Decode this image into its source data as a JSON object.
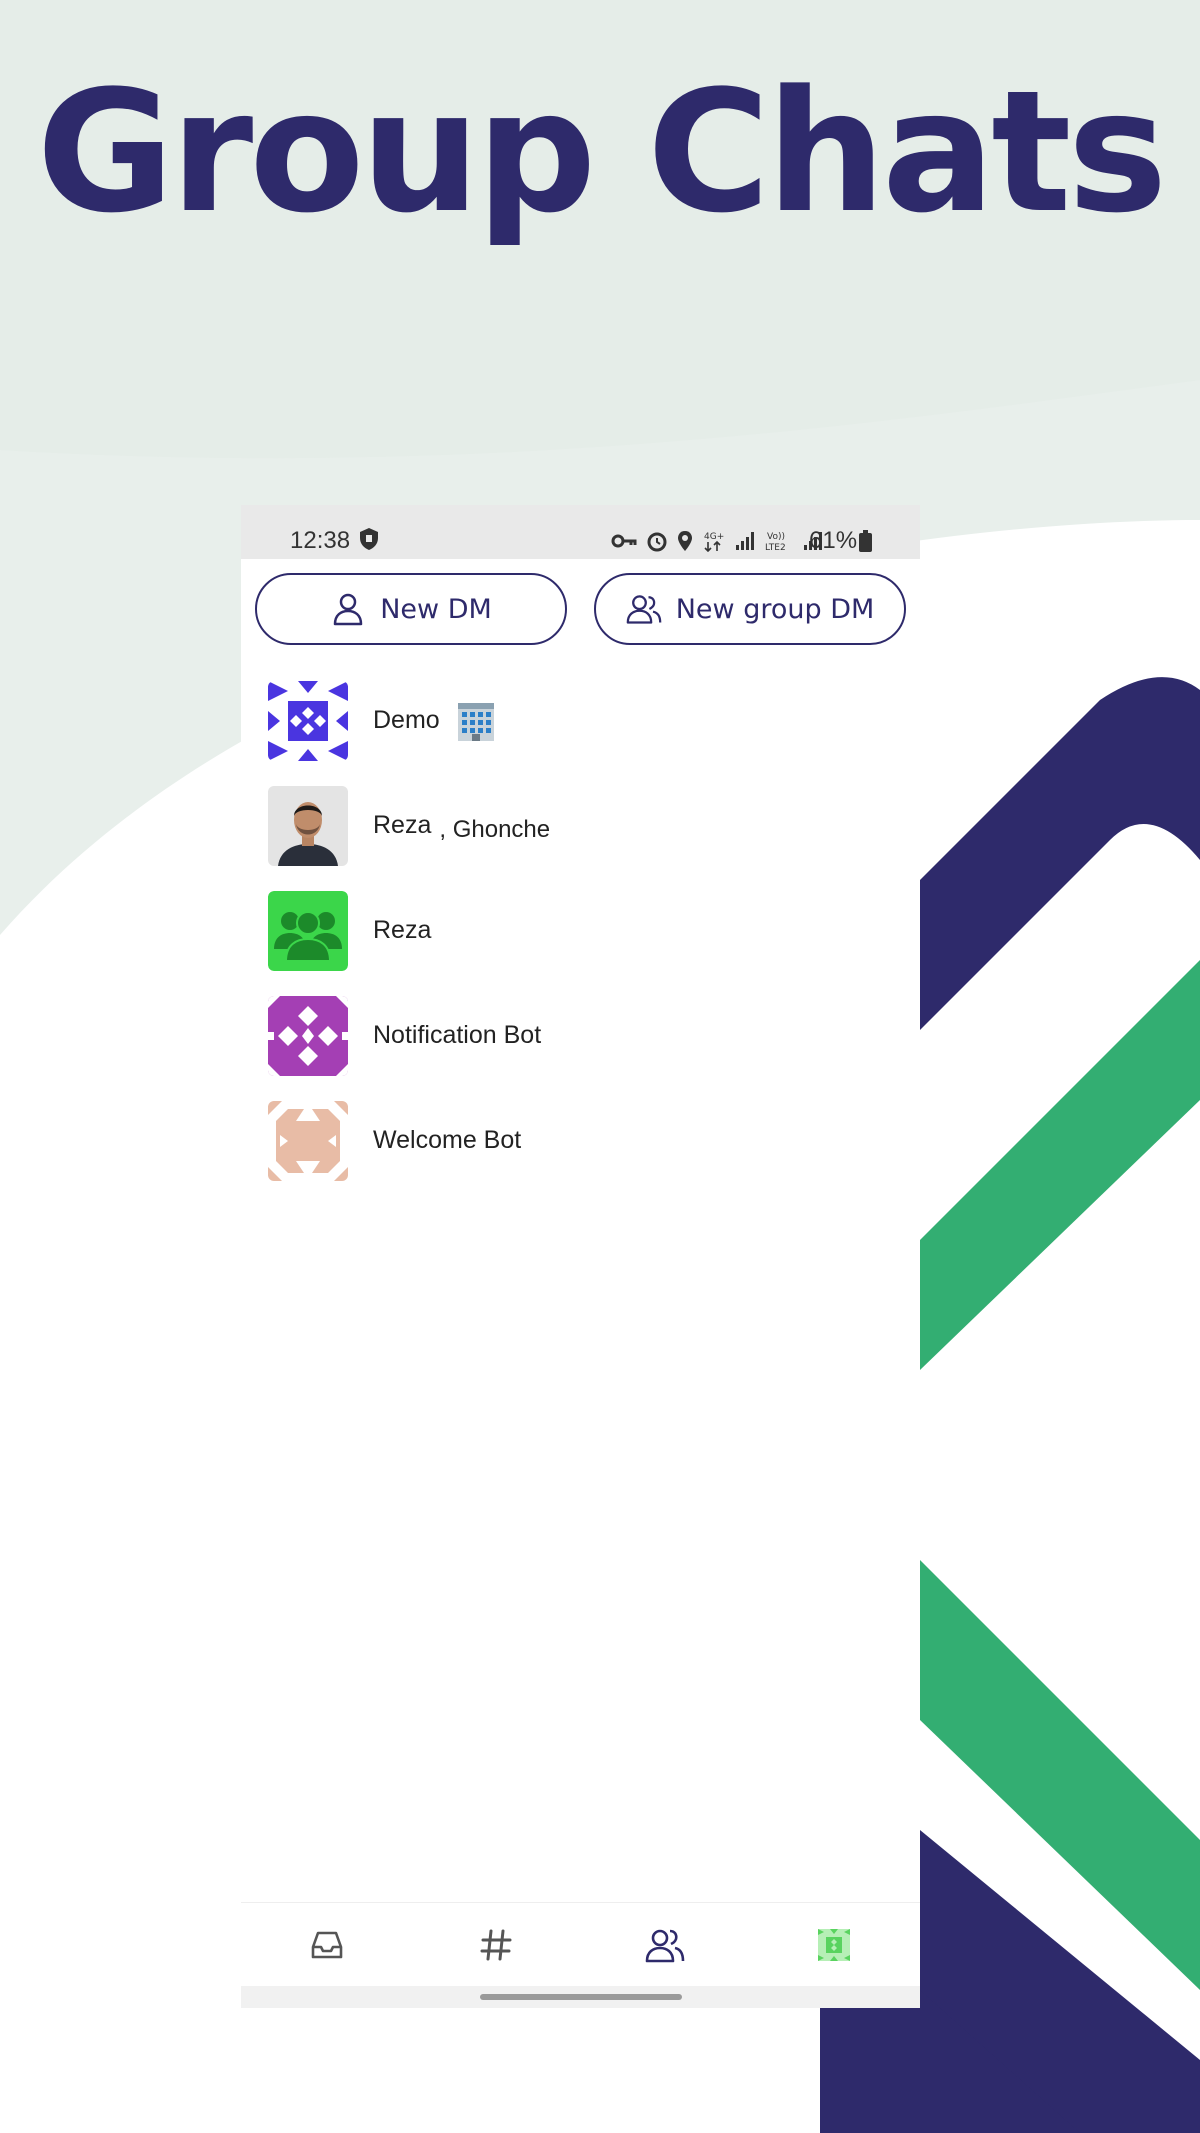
{
  "headline": "Group Chats",
  "colors": {
    "brand_navy": "#2e2a6b",
    "brand_green": "#33ae72",
    "background_mint": "#e8efeb"
  },
  "status_bar": {
    "time": "12:38",
    "battery_percent": "61%",
    "icons": [
      "shield-icon",
      "vpn-key-icon",
      "alarm-icon",
      "location-icon",
      "4g-icon",
      "signal-icon",
      "volte-icon",
      "signal-icon",
      "battery-icon"
    ]
  },
  "actions": {
    "new_dm_label": "New DM",
    "new_group_dm_label": "New group DM"
  },
  "dm_list": [
    {
      "name": "Demo",
      "extra": "",
      "avatar": "identicon-blue",
      "emoji": "building-emoji"
    },
    {
      "name": "Reza",
      "extra": ", Ghonche",
      "avatar": "photo-avatar"
    },
    {
      "name": "Reza",
      "extra": "",
      "avatar": "group-avatar-green"
    },
    {
      "name": "Notification Bot",
      "extra": "",
      "avatar": "identicon-purple"
    },
    {
      "name": "Welcome Bot",
      "extra": "",
      "avatar": "identicon-peach"
    }
  ],
  "bottom_nav": [
    {
      "name": "inbox-icon",
      "active": false
    },
    {
      "name": "streams-hash-icon",
      "active": false
    },
    {
      "name": "direct-messages-icon",
      "active": true
    },
    {
      "name": "profile-identicon-icon",
      "active": false
    }
  ]
}
